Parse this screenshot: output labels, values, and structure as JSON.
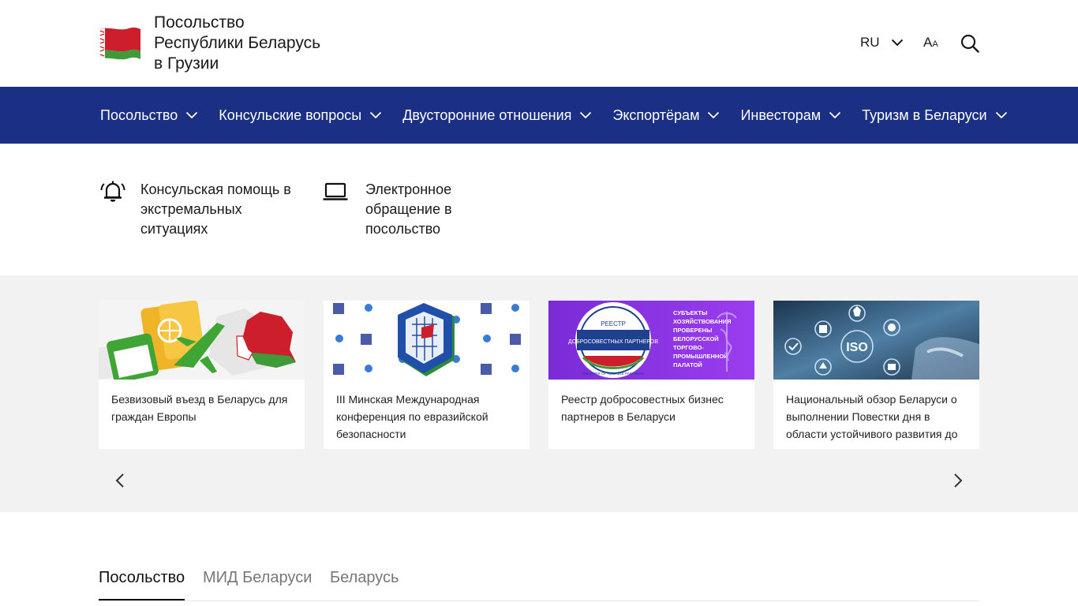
{
  "header": {
    "title_lines": [
      "Посольство",
      "Республики Беларусь",
      "в Грузии"
    ],
    "flag_icon": "belarus-flag-icon",
    "language": "RU",
    "font_size_label_big": "A",
    "font_size_label_small": "A",
    "search_icon": "search-icon"
  },
  "nav": {
    "background": "#1b2f84",
    "items": [
      {
        "label": "Посольство"
      },
      {
        "label": "Консульские вопросы"
      },
      {
        "label": "Двусторонние отношения"
      },
      {
        "label": "Экспортёрам"
      },
      {
        "label": "Инвесторам"
      },
      {
        "label": "Туризм в Беларуси"
      }
    ]
  },
  "quick_links": [
    {
      "icon": "alarm-bell-icon",
      "label": "Консульская помощь в экстремальных ситуациях"
    },
    {
      "icon": "laptop-icon",
      "label": "Электронное обращение в посольство"
    }
  ],
  "carousel": {
    "cards": [
      {
        "caption": "Безвизовый въезд в Беларусь для граждан Европы",
        "image": "visa-free-travel-illustration"
      },
      {
        "caption": "III Минская Международная конференция по евразийской безопасности",
        "image": "eurasian-security-conference-logo"
      },
      {
        "caption": "Реестр добросовестных бизнес партнеров в Беларуси",
        "image": "register-of-reliable-partners-banner",
        "image_text": {
          "seal_top": "РЕЕСТР",
          "seal_main": "ДОБРОСОВЕСТНЫХ ПАРТНЕРОВ",
          "seal_ring": "REGISTER OF RELIABLE PARTNERS",
          "side_lines": [
            "СУБЪЕКТЫ",
            "ХОЗЯЙСТВОВАНИЯ",
            "ПРОВЕРЕНЫ",
            "БЕЛОРУССКОЙ",
            "ТОРГОВО-",
            "ПРОМЫШЛЕННОЙ",
            "ПАЛАТОЙ"
          ]
        }
      },
      {
        "caption": "Национальный обзор Беларуси о выполнении Повестки дня в области устойчивого развития до",
        "image": "iso-digital-icons-photo",
        "image_text": {
          "iso": "ISO"
        }
      }
    ],
    "prev_icon": "chevron-left-icon",
    "next_icon": "chevron-right-icon"
  },
  "tabs": {
    "items": [
      {
        "label": "Посольство",
        "active": true
      },
      {
        "label": "МИД Беларуси",
        "active": false
      },
      {
        "label": "Беларусь",
        "active": false
      }
    ]
  }
}
